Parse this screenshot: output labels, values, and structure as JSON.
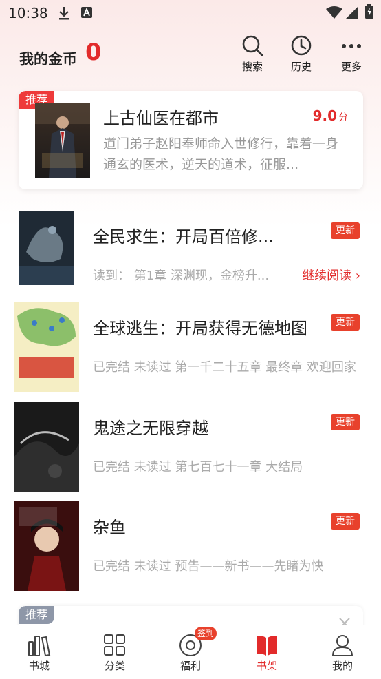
{
  "status_bar": {
    "time": "10:38"
  },
  "header": {
    "coin_label": "我的金币",
    "coin_value": "0",
    "actions": [
      {
        "label": "搜索",
        "icon": "search-icon"
      },
      {
        "label": "历史",
        "icon": "history-icon"
      },
      {
        "label": "更多",
        "icon": "more-icon"
      }
    ]
  },
  "recommend": {
    "badge": "推荐",
    "title": "上古仙医在都市",
    "score": "9.0",
    "score_unit": "分",
    "description": "道门弟子赵阳奉师命入世修行，靠着一身通玄的医术，逆天的道术，征服..."
  },
  "books": [
    {
      "title": "全民求生：开局百倍修...",
      "meta": "读到： 第1章 深渊现，金榜升...",
      "badge": "更新",
      "continue_label": "继续阅读 ›"
    },
    {
      "title": "全球逃生：开局获得无德地图",
      "meta": "已完结 未读过 第一千二十五章 最终章 欢迎回家",
      "badge": "更新"
    },
    {
      "title": "鬼途之无限穿越",
      "meta": "已完结 未读过 第七百七十一章 大结局",
      "badge": "更新"
    },
    {
      "title": "杂鱼",
      "meta": "已完结 未读过 预告——新书——先睹为快",
      "badge": "更新"
    }
  ],
  "recommend2": {
    "badge": "推荐"
  },
  "tabs": [
    {
      "label": "书城",
      "icon": "bookstore-icon"
    },
    {
      "label": "分类",
      "icon": "category-icon"
    },
    {
      "label": "福利",
      "icon": "welfare-icon",
      "badge": "签到"
    },
    {
      "label": "书架",
      "icon": "bookshelf-icon",
      "active": true
    },
    {
      "label": "我的",
      "icon": "profile-icon"
    }
  ],
  "colors": {
    "accent": "#e22b2b",
    "badge_red": "#e8412c",
    "tag_gray": "#8e97a8"
  }
}
